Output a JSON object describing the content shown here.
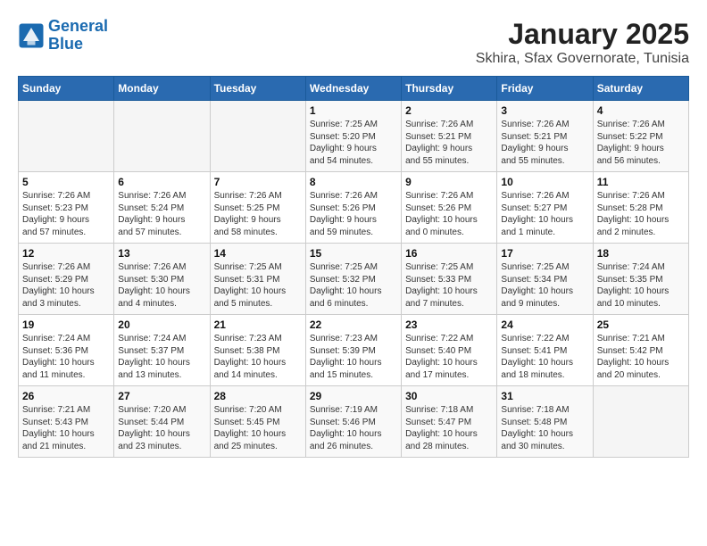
{
  "logo": {
    "line1": "General",
    "line2": "Blue"
  },
  "title": "January 2025",
  "subtitle": "Skhira, Sfax Governorate, Tunisia",
  "weekdays": [
    "Sunday",
    "Monday",
    "Tuesday",
    "Wednesday",
    "Thursday",
    "Friday",
    "Saturday"
  ],
  "weeks": [
    [
      {
        "day": "",
        "info": ""
      },
      {
        "day": "",
        "info": ""
      },
      {
        "day": "",
        "info": ""
      },
      {
        "day": "1",
        "info": "Sunrise: 7:25 AM\nSunset: 5:20 PM\nDaylight: 9 hours\nand 54 minutes."
      },
      {
        "day": "2",
        "info": "Sunrise: 7:26 AM\nSunset: 5:21 PM\nDaylight: 9 hours\nand 55 minutes."
      },
      {
        "day": "3",
        "info": "Sunrise: 7:26 AM\nSunset: 5:21 PM\nDaylight: 9 hours\nand 55 minutes."
      },
      {
        "day": "4",
        "info": "Sunrise: 7:26 AM\nSunset: 5:22 PM\nDaylight: 9 hours\nand 56 minutes."
      }
    ],
    [
      {
        "day": "5",
        "info": "Sunrise: 7:26 AM\nSunset: 5:23 PM\nDaylight: 9 hours\nand 57 minutes."
      },
      {
        "day": "6",
        "info": "Sunrise: 7:26 AM\nSunset: 5:24 PM\nDaylight: 9 hours\nand 57 minutes."
      },
      {
        "day": "7",
        "info": "Sunrise: 7:26 AM\nSunset: 5:25 PM\nDaylight: 9 hours\nand 58 minutes."
      },
      {
        "day": "8",
        "info": "Sunrise: 7:26 AM\nSunset: 5:26 PM\nDaylight: 9 hours\nand 59 minutes."
      },
      {
        "day": "9",
        "info": "Sunrise: 7:26 AM\nSunset: 5:26 PM\nDaylight: 10 hours\nand 0 minutes."
      },
      {
        "day": "10",
        "info": "Sunrise: 7:26 AM\nSunset: 5:27 PM\nDaylight: 10 hours\nand 1 minute."
      },
      {
        "day": "11",
        "info": "Sunrise: 7:26 AM\nSunset: 5:28 PM\nDaylight: 10 hours\nand 2 minutes."
      }
    ],
    [
      {
        "day": "12",
        "info": "Sunrise: 7:26 AM\nSunset: 5:29 PM\nDaylight: 10 hours\nand 3 minutes."
      },
      {
        "day": "13",
        "info": "Sunrise: 7:26 AM\nSunset: 5:30 PM\nDaylight: 10 hours\nand 4 minutes."
      },
      {
        "day": "14",
        "info": "Sunrise: 7:25 AM\nSunset: 5:31 PM\nDaylight: 10 hours\nand 5 minutes."
      },
      {
        "day": "15",
        "info": "Sunrise: 7:25 AM\nSunset: 5:32 PM\nDaylight: 10 hours\nand 6 minutes."
      },
      {
        "day": "16",
        "info": "Sunrise: 7:25 AM\nSunset: 5:33 PM\nDaylight: 10 hours\nand 7 minutes."
      },
      {
        "day": "17",
        "info": "Sunrise: 7:25 AM\nSunset: 5:34 PM\nDaylight: 10 hours\nand 9 minutes."
      },
      {
        "day": "18",
        "info": "Sunrise: 7:24 AM\nSunset: 5:35 PM\nDaylight: 10 hours\nand 10 minutes."
      }
    ],
    [
      {
        "day": "19",
        "info": "Sunrise: 7:24 AM\nSunset: 5:36 PM\nDaylight: 10 hours\nand 11 minutes."
      },
      {
        "day": "20",
        "info": "Sunrise: 7:24 AM\nSunset: 5:37 PM\nDaylight: 10 hours\nand 13 minutes."
      },
      {
        "day": "21",
        "info": "Sunrise: 7:23 AM\nSunset: 5:38 PM\nDaylight: 10 hours\nand 14 minutes."
      },
      {
        "day": "22",
        "info": "Sunrise: 7:23 AM\nSunset: 5:39 PM\nDaylight: 10 hours\nand 15 minutes."
      },
      {
        "day": "23",
        "info": "Sunrise: 7:22 AM\nSunset: 5:40 PM\nDaylight: 10 hours\nand 17 minutes."
      },
      {
        "day": "24",
        "info": "Sunrise: 7:22 AM\nSunset: 5:41 PM\nDaylight: 10 hours\nand 18 minutes."
      },
      {
        "day": "25",
        "info": "Sunrise: 7:21 AM\nSunset: 5:42 PM\nDaylight: 10 hours\nand 20 minutes."
      }
    ],
    [
      {
        "day": "26",
        "info": "Sunrise: 7:21 AM\nSunset: 5:43 PM\nDaylight: 10 hours\nand 21 minutes."
      },
      {
        "day": "27",
        "info": "Sunrise: 7:20 AM\nSunset: 5:44 PM\nDaylight: 10 hours\nand 23 minutes."
      },
      {
        "day": "28",
        "info": "Sunrise: 7:20 AM\nSunset: 5:45 PM\nDaylight: 10 hours\nand 25 minutes."
      },
      {
        "day": "29",
        "info": "Sunrise: 7:19 AM\nSunset: 5:46 PM\nDaylight: 10 hours\nand 26 minutes."
      },
      {
        "day": "30",
        "info": "Sunrise: 7:18 AM\nSunset: 5:47 PM\nDaylight: 10 hours\nand 28 minutes."
      },
      {
        "day": "31",
        "info": "Sunrise: 7:18 AM\nSunset: 5:48 PM\nDaylight: 10 hours\nand 30 minutes."
      },
      {
        "day": "",
        "info": ""
      }
    ]
  ]
}
